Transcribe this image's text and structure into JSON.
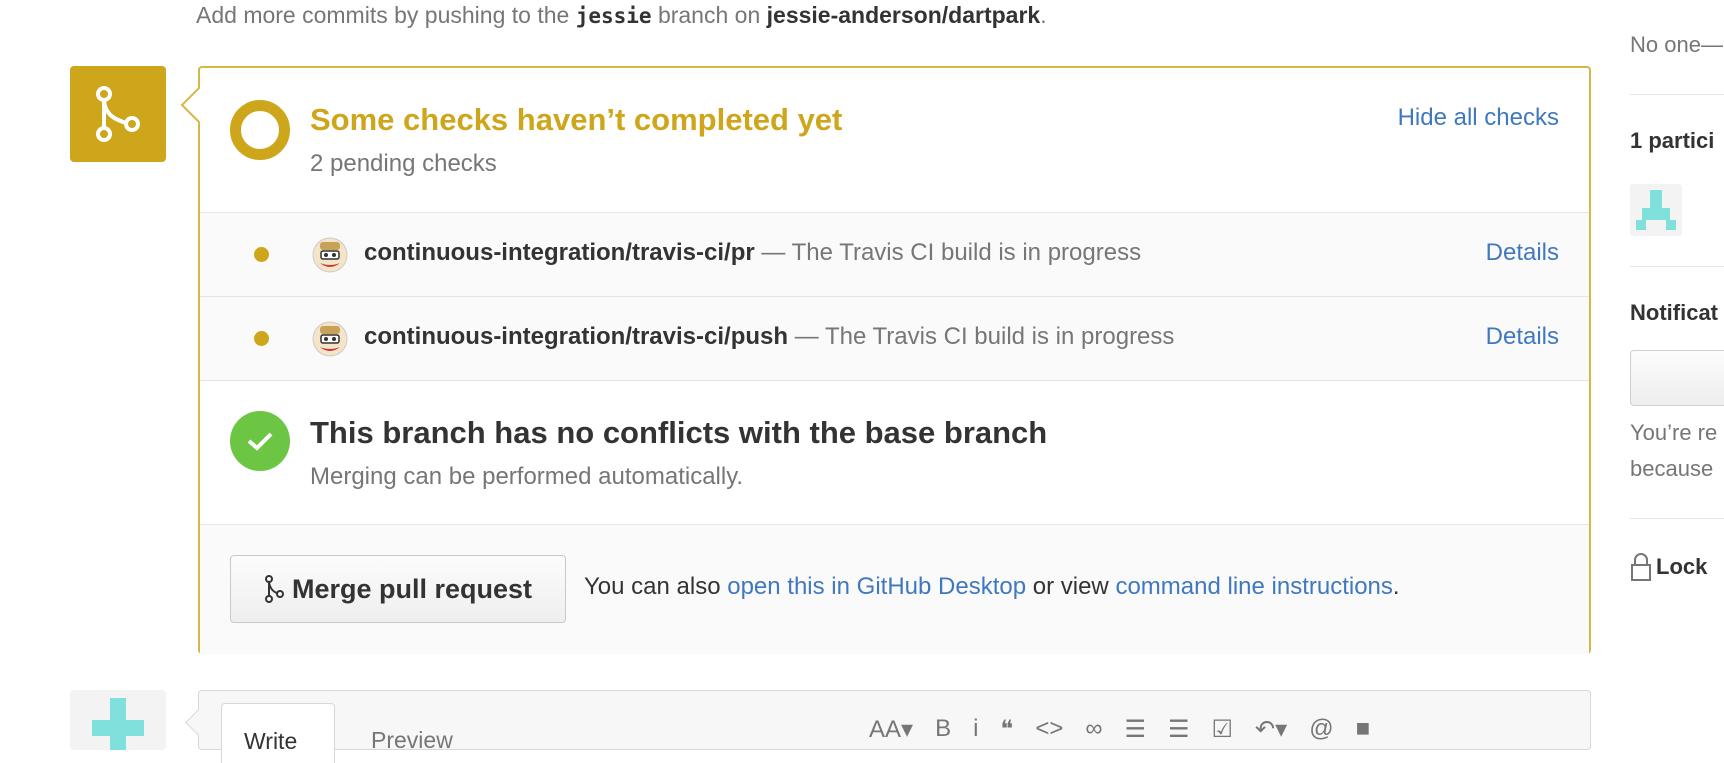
{
  "top_note": {
    "prefix": "Add more commits by pushing to the",
    "branch": "jessie",
    "middle": "branch on",
    "repo": "jessie-anderson/dartpark",
    "suffix": "."
  },
  "status": {
    "title": "Some checks haven’t completed yet",
    "subtitle": "2 pending checks",
    "toggle_label": "Hide all checks"
  },
  "checks": [
    {
      "name": "continuous-integration/travis-ci/pr",
      "separator": "—",
      "description": "The Travis CI build is in progress",
      "details_label": "Details"
    },
    {
      "name": "continuous-integration/travis-ci/push",
      "separator": "—",
      "description": "The Travis CI build is in progress",
      "details_label": "Details"
    }
  ],
  "conflicts": {
    "title": "This branch has no conflicts with the base branch",
    "subtitle": "Merging can be performed automatically."
  },
  "merge": {
    "button_label": "Merge pull request",
    "alt_prefix": "You can also",
    "desktop_link": "open this in GitHub Desktop",
    "alt_middle": "or view",
    "cli_link": "command line instructions",
    "alt_suffix": "."
  },
  "comment": {
    "tab_write": "Write",
    "tab_preview": "Preview"
  },
  "sidebar": {
    "assignees_value": "No one—",
    "participants_heading": "1 partici",
    "notifications_heading": "Notificat",
    "notif_line1": "You’re re",
    "notif_line2": "because",
    "lock_label": "Lock"
  },
  "colors": {
    "pending": "#cea61b",
    "success": "#6cc644",
    "link": "#4078c0"
  }
}
